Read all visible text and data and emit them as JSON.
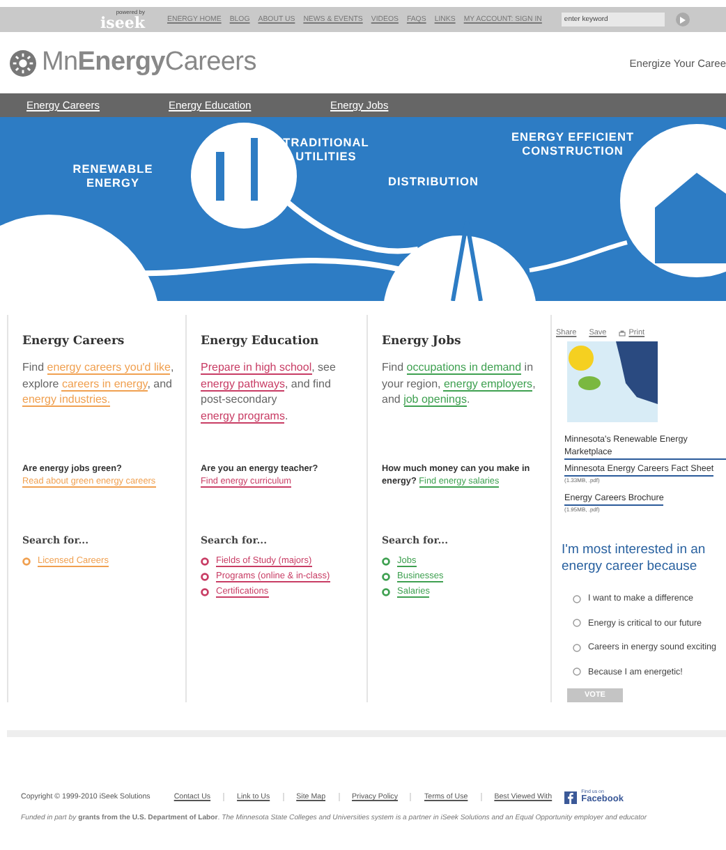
{
  "top_bar": {
    "powered_by": "powered by",
    "brand": "iseek",
    "nav": [
      "ENERGY HOME",
      "BLOG",
      "ABOUT US",
      "NEWS & EVENTS",
      "VIDEOS",
      "FAQS",
      "LINKS",
      "MY ACCOUNT: SIGN IN"
    ],
    "search": {
      "placeholder": "enter keyword"
    }
  },
  "header": {
    "logo": "Mn**Energy**Careers",
    "tagline": "Energize Your Caree"
  },
  "nav": [
    "Energy Careers",
    "Energy Education",
    "Energy Jobs"
  ],
  "banner": {
    "labels": [
      "RENEWABLE ENERGY",
      "TRADITIONAL UTILITIES",
      "DISTRIBUTION",
      "ENERGY EFFICIENT CONSTRUCTION"
    ]
  },
  "columns": [
    {
      "title": "Energy Careers",
      "color": "#f0a050",
      "intro": [
        {
          "text": "Find ",
          "link": false
        },
        {
          "text": "energy careers you'd like",
          "link": true
        },
        {
          "text": ", explore ",
          "link": false
        },
        {
          "text": "careers in energy",
          "link": true
        },
        {
          "text": ", and ",
          "link": false
        },
        {
          "text": "energy industries.",
          "link": true
        }
      ],
      "question": [
        {
          "text": "Are energy jobs green? ",
          "link": false
        },
        {
          "text": "Read about green energy careers",
          "link": true
        }
      ],
      "search_heading": "Search for...",
      "links": [
        "Licensed Careers"
      ]
    },
    {
      "title": "Energy Education",
      "color": "#c83c64",
      "intro": [
        {
          "text": "Prepare in high school",
          "link": true
        },
        {
          "text": ", see ",
          "link": false
        },
        {
          "text": "energy pathways",
          "link": true
        },
        {
          "text": ", and find post-secondary ",
          "link": false
        },
        {
          "text": "energy programs",
          "link": true
        },
        {
          "text": ".",
          "link": false
        }
      ],
      "question": [
        {
          "text": "Are you an energy teacher? ",
          "link": false
        },
        {
          "text": "Find energy curriculum",
          "link": true
        }
      ],
      "search_heading": "Search for...",
      "links": [
        "Fields of Study (majors)",
        "Programs (online & in-class)",
        "Certifications"
      ]
    },
    {
      "title": "Energy Jobs",
      "color": "#3ea050",
      "intro": [
        {
          "text": "Find ",
          "link": false
        },
        {
          "text": "occupations in demand",
          "link": true
        },
        {
          "text": " in your region, ",
          "link": false
        },
        {
          "text": "energy employers",
          "link": true
        },
        {
          "text": ", and ",
          "link": false
        },
        {
          "text": "job openings",
          "link": true
        },
        {
          "text": ".",
          "link": false
        }
      ],
      "question": [
        {
          "text": "How much money can you make in energy? ",
          "link": false
        },
        {
          "text": "Find energy salaries",
          "link": true
        }
      ],
      "search_heading": "Search for...",
      "links": [
        "Jobs",
        "Businesses",
        "Salaries"
      ]
    }
  ],
  "sidebar": {
    "tools": [
      "Share",
      "Save",
      "Print"
    ],
    "links": [
      {
        "title": "Minnesota's Renewable Energy Marketplace"
      },
      {
        "title": "Minnesota Energy Careers Fact Sheet",
        "meta": "(1.33MB, .pdf)"
      },
      {
        "title": "Energy Careers Brochure",
        "meta": "(1.95MB, .pdf)"
      }
    ],
    "poll": {
      "question": "I'm most interested in an energy career because",
      "options": [
        {
          "label": "I want to make a difference",
          "selected": false
        },
        {
          "label": "Energy is critical to our future",
          "selected": false
        },
        {
          "label": "Careers in energy sound exciting",
          "selected": false
        },
        {
          "label": "Because I am energetic!",
          "selected": false
        }
      ],
      "button": "VOTE"
    }
  },
  "footer": {
    "copyright": "Copyright © 1999-2010 iSeek Solutions",
    "links": [
      "Contact Us",
      "Link to Us",
      "Site Map",
      "Privacy Policy",
      "Terms of Use",
      "Best Viewed With"
    ],
    "facebook": {
      "small": "Find us on",
      "label": "Facebook"
    },
    "note": "*Funded in part by* **grants from the U.S. Department of Labor**. *The Minnesota State Colleges and Universities system is a partner in iSeek Solutions and an Equal Opportunity employer and educator*"
  }
}
